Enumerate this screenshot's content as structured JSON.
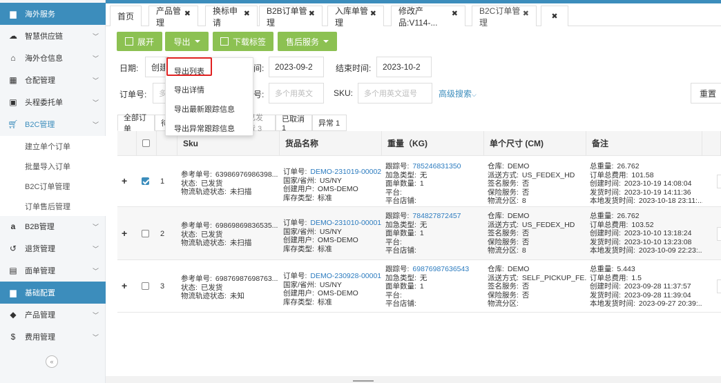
{
  "sidebar": {
    "items": [
      {
        "label": "海外服务",
        "icon": "folder-icon",
        "chev": false
      },
      {
        "label": "智慧供应链",
        "icon": "cloud-icon",
        "chev": true
      },
      {
        "label": "海外仓信息",
        "icon": "home-icon",
        "chev": true
      },
      {
        "label": "仓配管理",
        "icon": "grid-icon",
        "chev": true
      },
      {
        "label": "头程委托单",
        "icon": "briefcase-icon",
        "chev": true
      },
      {
        "label": "B2C管理",
        "icon": "cart-icon",
        "chev": true
      },
      {
        "label": "B2B管理",
        "icon": "amazon-icon",
        "chev": true
      },
      {
        "label": "退货管理",
        "icon": "return-icon",
        "chev": true
      },
      {
        "label": "面单管理",
        "icon": "document-icon",
        "chev": true
      },
      {
        "label": "基础配置",
        "icon": "folder-icon",
        "chev": false
      },
      {
        "label": "产品管理",
        "icon": "tag-icon",
        "chev": true
      },
      {
        "label": "费用管理",
        "icon": "dollar-icon",
        "chev": true
      }
    ],
    "b2c_sub": [
      "建立单个订单",
      "批量导入订单",
      "B2C订单管理",
      "订单售后管理"
    ],
    "collapse": "«"
  },
  "tabs": [
    {
      "label": "首页",
      "close": ""
    },
    {
      "label": "产品管理",
      "close": "✖"
    },
    {
      "label": "换标申请",
      "close": "✖"
    },
    {
      "label": "B2B订单管理",
      "close": "✖"
    },
    {
      "label": "入库单管理",
      "close": "✖"
    },
    {
      "label": "修改产品:V114-...",
      "close": "✖"
    },
    {
      "label": "B2C订单管理",
      "close": "✖"
    },
    {
      "label": "",
      "close": "✖"
    }
  ],
  "toolbar": {
    "expand": "展开",
    "export": "导出",
    "download_label": "下载标签",
    "after_sales": "售后服务"
  },
  "filters": {
    "date_label": "日期:",
    "date_type": "创建",
    "date_suffix": "间:",
    "start_date": "2023-09-2",
    "end_label": "结束时间:",
    "end_date": "2023-10-2",
    "order_no_label": "订单号:",
    "order_placeholder": "多",
    "field2_suffix": "号:",
    "field2_placeholder": "多个用英文",
    "sku_label": "SKU:",
    "sku_placeholder": "多个用英文逗号",
    "advanced": "高级搜索",
    "reset": "重置"
  },
  "status_tabs": [
    "全部订单",
    "待",
    "已发货 3",
    "已取消 1",
    "异常 1"
  ],
  "table": {
    "headers": [
      "Sku",
      "货品名称",
      "重量（KG)",
      "单个尺寸 (CM)",
      "备注"
    ],
    "rows": [
      {
        "index": "1",
        "checked": true,
        "sku": [
          [
            "参考单号:",
            "63986976986398..."
          ],
          [
            "状态:",
            "已发货"
          ],
          [
            "物流轨迹状态:",
            "未扫描"
          ]
        ],
        "goods": [
          [
            "订单号:",
            "DEMO-231019-00002"
          ],
          [
            "国家/省州:",
            "US/NY"
          ],
          [
            "创建用户:",
            "OMS-DEMO"
          ],
          [
            "库存类型:",
            "标准"
          ]
        ],
        "weight": [
          [
            "跟踪号:",
            "785246831350"
          ],
          [
            "加急类型:",
            "无"
          ],
          [
            "面单数量:",
            "1"
          ],
          [
            "平台:",
            ""
          ],
          [
            "平台店铺:",
            ""
          ]
        ],
        "size": [
          [
            "仓库:",
            "DEMO"
          ],
          [
            "派送方式:",
            "US_FEDEX_HD"
          ],
          [
            "签名服务:",
            "否"
          ],
          [
            "保险服务:",
            "否"
          ],
          [
            "物流分区:",
            "8"
          ]
        ],
        "remark": [
          [
            "总重量:",
            "26.762"
          ],
          [
            "订单总费用:",
            "101.58"
          ],
          [
            "创建时间:",
            "2023-10-19 14:08:04"
          ],
          [
            "发货时间:",
            "2023-10-19 14:11:36"
          ],
          [
            "本地发货时间:",
            "2023-10-18 23:11:..."
          ]
        ]
      },
      {
        "index": "2",
        "checked": false,
        "sku": [
          [
            "参考单号:",
            "69869869836535..."
          ],
          [
            "状态:",
            "已发货"
          ],
          [
            "物流轨迹状态:",
            "未扫描"
          ]
        ],
        "goods": [
          [
            "订单号:",
            "DEMO-231010-00001"
          ],
          [
            "国家/省州:",
            "US/NY"
          ],
          [
            "创建用户:",
            "OMS-DEMO"
          ],
          [
            "库存类型:",
            "标准"
          ]
        ],
        "weight": [
          [
            "跟踪号:",
            "784827872457"
          ],
          [
            "加急类型:",
            "无"
          ],
          [
            "面单数量:",
            "1"
          ],
          [
            "平台:",
            ""
          ],
          [
            "平台店铺:",
            ""
          ]
        ],
        "size": [
          [
            "仓库:",
            "DEMO"
          ],
          [
            "派送方式:",
            "US_FEDEX_HD"
          ],
          [
            "签名服务:",
            "否"
          ],
          [
            "保险服务:",
            "否"
          ],
          [
            "物流分区:",
            "8"
          ]
        ],
        "remark": [
          [
            "总重量:",
            "26.762"
          ],
          [
            "订单总费用:",
            "103.52"
          ],
          [
            "创建时间:",
            "2023-10-10 13:18:24"
          ],
          [
            "发货时间:",
            "2023-10-10 13:23:08"
          ],
          [
            "本地发货时间:",
            "2023-10-09 22:23:..."
          ]
        ]
      },
      {
        "index": "3",
        "checked": false,
        "sku": [
          [
            "参考单号:",
            "69876987698763..."
          ],
          [
            "状态:",
            "已发货"
          ],
          [
            "物流轨迹状态:",
            "未知"
          ]
        ],
        "goods": [
          [
            "订单号:",
            "DEMO-230928-00001"
          ],
          [
            "国家/省州:",
            "US/NY"
          ],
          [
            "创建用户:",
            "OMS-DEMO"
          ],
          [
            "库存类型:",
            "标准"
          ]
        ],
        "weight": [
          [
            "跟踪号:",
            "69876987636543"
          ],
          [
            "加急类型:",
            "无"
          ],
          [
            "面单数量:",
            "1"
          ],
          [
            "平台:",
            ""
          ],
          [
            "平台店铺:",
            ""
          ]
        ],
        "size": [
          [
            "仓库:",
            "DEMO"
          ],
          [
            "派送方式:",
            "SELF_PICKUP_FE..."
          ],
          [
            "签名服务:",
            "否"
          ],
          [
            "保险服务:",
            "否"
          ],
          [
            "物流分区:",
            ""
          ]
        ],
        "remark": [
          [
            "总重量:",
            "5.443"
          ],
          [
            "订单总费用:",
            "1.5"
          ],
          [
            "创建时间:",
            "2023-09-28 11:37:57"
          ],
          [
            "发货时间:",
            "2023-09-28 11:39:04"
          ],
          [
            "本地发货时间:",
            "2023-09-27 20:39:..."
          ]
        ]
      }
    ]
  },
  "dropdown": [
    "导出列表",
    "导出详情",
    "导出最新跟踪信息",
    "导出异常跟踪信息"
  ],
  "colors": {
    "accent": "#3c8dbc",
    "button": "#8cc152",
    "highlight": "#e02020"
  }
}
